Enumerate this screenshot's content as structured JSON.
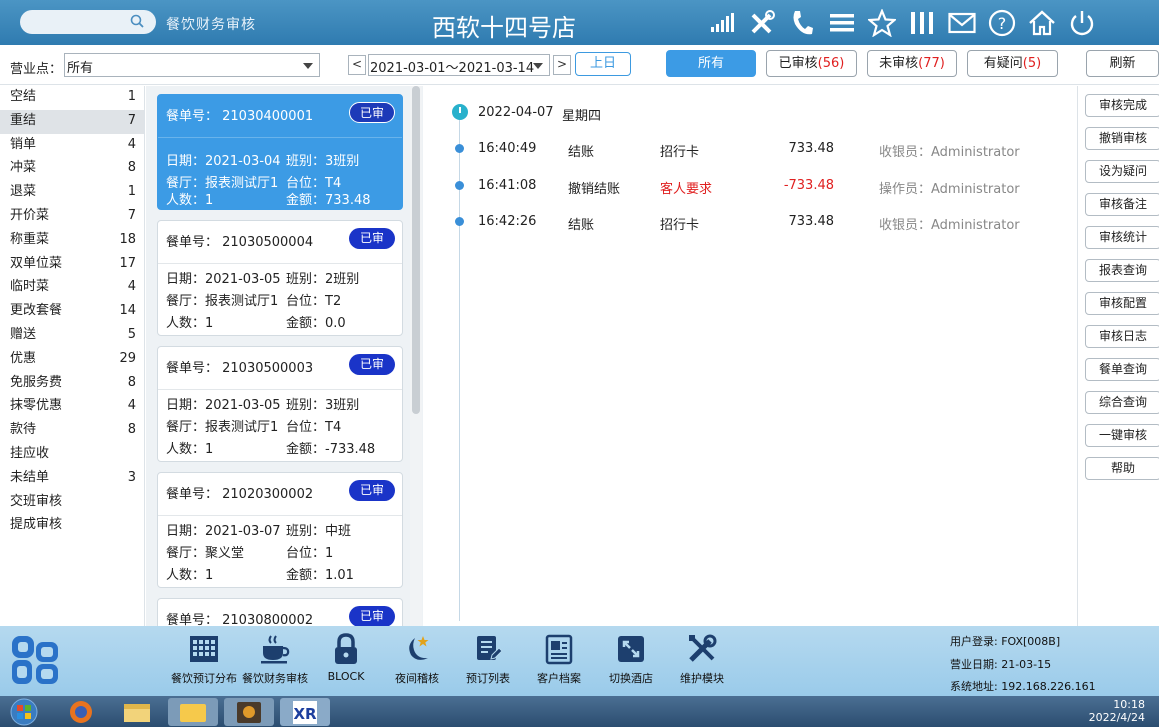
{
  "header": {
    "search_placeholder": "",
    "module_title": "餐饮财务审核",
    "store_name": "西软十四号店",
    "icons": [
      "signal-icon",
      "tools-icon",
      "phone-icon",
      "menu-icon",
      "star-icon",
      "columns-icon",
      "mail-icon",
      "help-icon",
      "home-icon",
      "power-icon"
    ]
  },
  "toolbar": {
    "outlet_label": "营业点：",
    "outlet_value": "所有",
    "prev_symbol": "<",
    "next_symbol": ">",
    "date_range": "2021-03-01～2021-03-14",
    "prev_day_label": "上日",
    "filters": [
      {
        "label": "所有",
        "count": ""
      },
      {
        "label": "已审核",
        "count": "(56)"
      },
      {
        "label": "未审核",
        "count": "(77)"
      },
      {
        "label": "有疑问",
        "count": "(5)"
      }
    ],
    "refresh_label": "刷新"
  },
  "categories": [
    {
      "label": "空结",
      "count": "1"
    },
    {
      "label": "重结",
      "count": "7"
    },
    {
      "label": "销单",
      "count": "4"
    },
    {
      "label": "冲菜",
      "count": "8"
    },
    {
      "label": "退菜",
      "count": "1"
    },
    {
      "label": "开价菜",
      "count": "7"
    },
    {
      "label": "称重菜",
      "count": "18"
    },
    {
      "label": "双单位菜",
      "count": "17"
    },
    {
      "label": "临时菜",
      "count": "4"
    },
    {
      "label": "更改套餐",
      "count": "14"
    },
    {
      "label": "赠送",
      "count": "5"
    },
    {
      "label": "优惠",
      "count": "29"
    },
    {
      "label": "免服务费",
      "count": "8"
    },
    {
      "label": "抹零优惠",
      "count": "4"
    },
    {
      "label": "款待",
      "count": "8"
    },
    {
      "label": "挂应收",
      "count": ""
    },
    {
      "label": "未结单",
      "count": "3"
    },
    {
      "label": "交班审核",
      "count": ""
    },
    {
      "label": "提成审核",
      "count": ""
    }
  ],
  "orders": [
    {
      "no": "餐单号： 21030400001",
      "badge": "已审",
      "date": "日期：2021-03-04",
      "shift": "班别：3班别",
      "hall": "餐厅：报表测试厅1",
      "table": "台位：T4",
      "people": "人数：1",
      "amount": "金额：733.48"
    },
    {
      "no": "餐单号： 21030500004",
      "badge": "已审",
      "date": "日期：2021-03-05",
      "shift": "班别：2班别",
      "hall": "餐厅：报表测试厅1",
      "table": "台位：T2",
      "people": "人数：1",
      "amount": "金额：0.0"
    },
    {
      "no": "餐单号： 21030500003",
      "badge": "已审",
      "date": "日期：2021-03-05",
      "shift": "班别：3班别",
      "hall": "餐厅：报表测试厅1",
      "table": "台位：T4",
      "people": "人数：1",
      "amount": "金额：-733.48"
    },
    {
      "no": "餐单号： 21020300002",
      "badge": "已审",
      "date": "日期：2021-03-07",
      "shift": "班别：中班",
      "hall": "餐厅：聚义堂",
      "table": "台位：1",
      "people": "人数：1",
      "amount": "金额：1.01"
    },
    {
      "no": "餐单号： 21030800002",
      "badge": "已审"
    }
  ],
  "timeline": {
    "date": "2022-04-07",
    "weekday": "星期四",
    "entries": [
      {
        "time": "16:40:49",
        "action": "结账",
        "method": "招行卡",
        "amount": "733.48",
        "operator": "收银员：Administrator"
      },
      {
        "time": "16:41:08",
        "action": "撤销结账",
        "method": "客人要求",
        "amount": "-733.48",
        "operator": "操作员：Administrator"
      },
      {
        "time": "16:42:26",
        "action": "结账",
        "method": "招行卡",
        "amount": "733.48",
        "operator": "收银员：Administrator"
      }
    ]
  },
  "actions": [
    "审核完成",
    "撤销审核",
    "设为疑问",
    "审核备注",
    "审核统计",
    "报表查询",
    "审核配置",
    "审核日志",
    "餐单查询",
    "综合查询",
    "一键审核",
    "帮助"
  ],
  "bottom": {
    "modules": [
      {
        "label": "餐饮预订分布",
        "icon": "calendar-grid-icon"
      },
      {
        "label": "餐饮财务审核",
        "icon": "coffee-cup-icon"
      },
      {
        "label": "BLOCK",
        "icon": "lock-icon"
      },
      {
        "label": "夜间稽核",
        "icon": "moon-icon"
      },
      {
        "label": "预订列表",
        "icon": "document-pen-icon"
      },
      {
        "label": "客户档案",
        "icon": "profile-card-icon"
      },
      {
        "label": "切换酒店",
        "icon": "switch-arrows-icon"
      },
      {
        "label": "维护模块",
        "icon": "wrench-icon"
      }
    ],
    "user_login": "用户登录: FOX[008B]",
    "business_date": "营业日期: 21-03-15",
    "system_address": "系统地址: 192.168.226.161"
  },
  "taskbar": {
    "time": "10:18",
    "date": "2022/4/24"
  },
  "colors": {
    "header_blue": "#3a87bb",
    "accent": "#3c9be5",
    "badge": "#1a34c8",
    "negative": "#e02020"
  }
}
